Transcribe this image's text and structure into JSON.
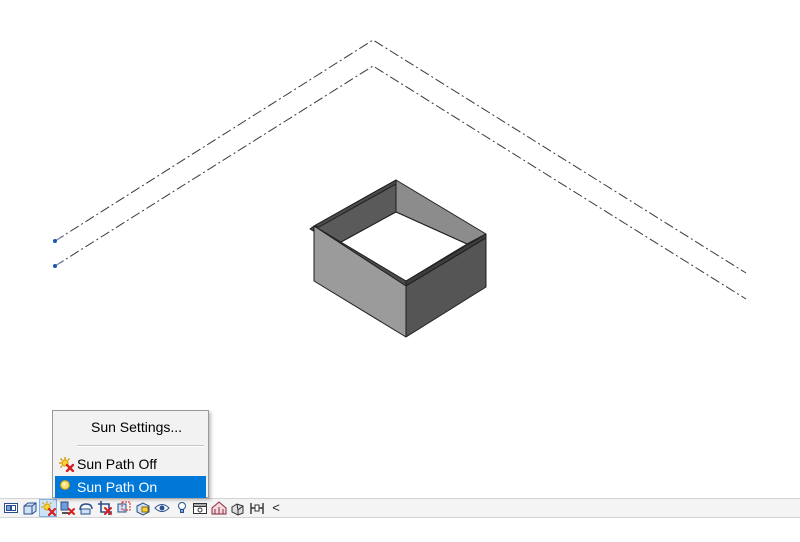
{
  "menu": {
    "items": [
      {
        "label": "Sun Settings...",
        "icon": "none"
      },
      {
        "label": "Sun Path Off",
        "icon": "sun-off-icon"
      },
      {
        "label": "Sun Path On",
        "icon": "sun-on-icon",
        "selected": true
      }
    ]
  },
  "view_control_bar": {
    "buttons": [
      "scale-icon",
      "detail-level-icon",
      "sun-path-icon",
      "shadows-icon",
      "show-rendering-dialog-icon",
      "crop-view-icon",
      "show-crop-region-icon",
      "unlock-3d-view-icon",
      "temporary-hide-isolate-icon",
      "reveal-hidden-elements-icon",
      "temporary-view-properties-icon",
      "show-analytical-model-icon",
      "highlight-displacement-icon",
      "reveal-constraints-icon",
      "collapse-chevron-icon"
    ],
    "chevron_glyph": "<"
  },
  "colors": {
    "selection": "#0078d7",
    "menu_background": "#f2f2f2",
    "wall_dark": "#555555",
    "wall_mid": "#7c7c7c",
    "wall_light": "#9a9a9a"
  }
}
